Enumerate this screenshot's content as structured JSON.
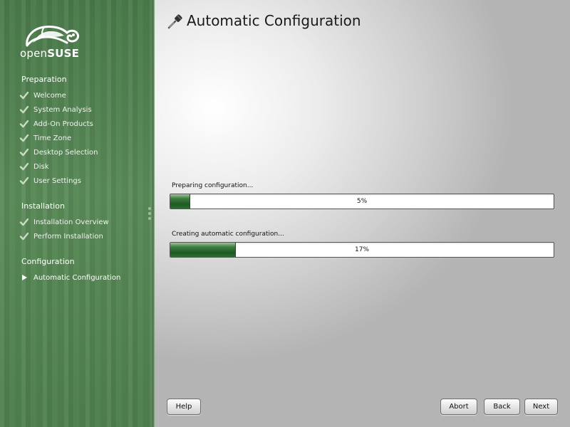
{
  "brand": {
    "logo_text_light": "open",
    "logo_text_bold": "SUSE",
    "logo_icon": "gecko-icon",
    "sidebar_color": "#4f7f4d"
  },
  "sidebar": {
    "sections": [
      {
        "title": "Preparation",
        "steps": [
          {
            "label": "Welcome",
            "status": "done"
          },
          {
            "label": "System Analysis",
            "status": "done"
          },
          {
            "label": "Add-On Products",
            "status": "done"
          },
          {
            "label": "Time Zone",
            "status": "done"
          },
          {
            "label": "Desktop Selection",
            "status": "done"
          },
          {
            "label": "Disk",
            "status": "done"
          },
          {
            "label": "User Settings",
            "status": "done"
          }
        ]
      },
      {
        "title": "Installation",
        "steps": [
          {
            "label": "Installation Overview",
            "status": "done"
          },
          {
            "label": "Perform Installation",
            "status": "done"
          }
        ]
      },
      {
        "title": "Configuration",
        "steps": [
          {
            "label": "Automatic Configuration",
            "status": "current"
          }
        ]
      }
    ]
  },
  "main": {
    "title": "Automatic Configuration",
    "title_icon": "wrench-screwdriver-icon",
    "progress": [
      {
        "label": "Preparing configuration...",
        "percent": 5,
        "text": "5%"
      },
      {
        "label": "Creating automatic configuration...",
        "percent": 17,
        "text": "17%"
      }
    ],
    "progress_fill_color": "#2f6e33"
  },
  "buttons": {
    "help": "Help",
    "abort": "Abort",
    "back": "Back",
    "next": "Next"
  }
}
